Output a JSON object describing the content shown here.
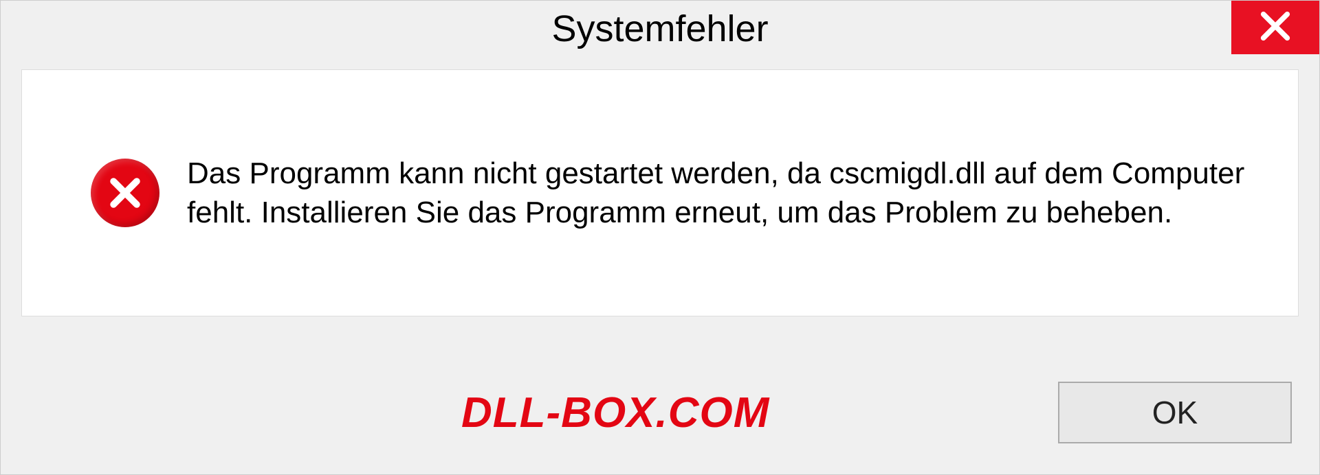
{
  "dialog": {
    "title": "Systemfehler",
    "message": "Das Programm kann nicht gestartet werden, da cscmigdl.dll auf dem Computer fehlt. Installieren Sie das Programm erneut, um das Problem zu beheben.",
    "ok_label": "OK"
  },
  "watermark": "DLL-BOX.COM"
}
